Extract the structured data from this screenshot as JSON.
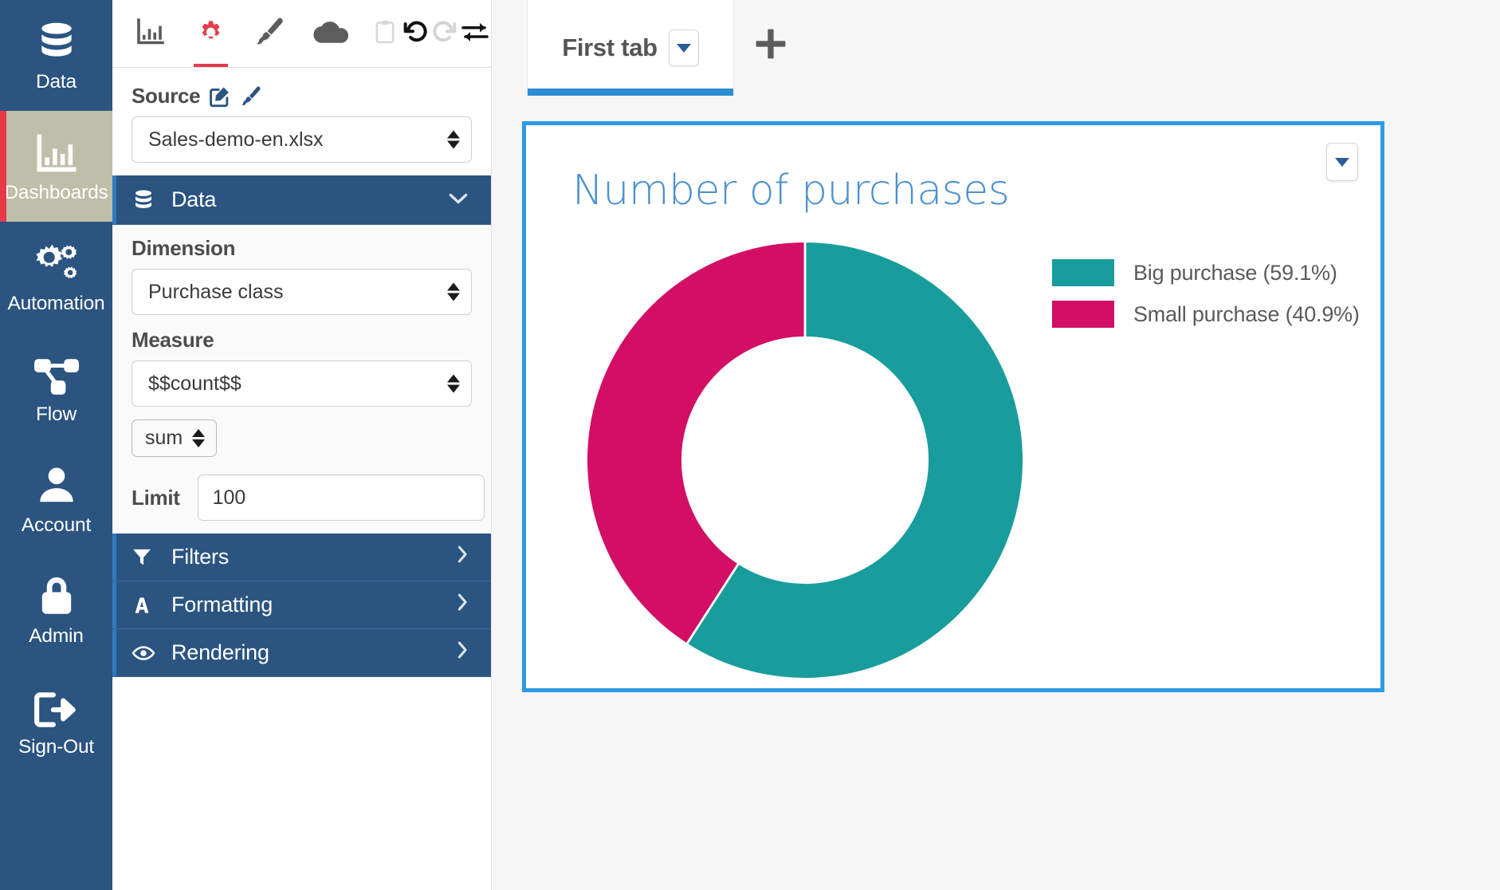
{
  "nav": {
    "items": [
      {
        "label": "Data",
        "icon": "database-icon",
        "active": false
      },
      {
        "label": "Dashboards",
        "icon": "bar-chart-icon",
        "active": true
      },
      {
        "label": "Automation",
        "icon": "gears-icon",
        "active": false
      },
      {
        "label": "Flow",
        "icon": "flow-nodes-icon",
        "active": false
      },
      {
        "label": "Account",
        "icon": "user-icon",
        "active": false
      },
      {
        "label": "Admin",
        "icon": "lock-icon",
        "active": false
      },
      {
        "label": "Sign-Out",
        "icon": "sign-out-icon",
        "active": false
      }
    ]
  },
  "toolstrip": {
    "tools": [
      {
        "name": "chart-icon",
        "state": "normal"
      },
      {
        "name": "gear-icon",
        "state": "active"
      },
      {
        "name": "paintbrush-icon",
        "state": "normal"
      },
      {
        "name": "cloud-icon",
        "state": "normal"
      },
      {
        "name": "clipboard-icon",
        "state": "disabled"
      },
      {
        "name": "undo-icon",
        "state": "enabled"
      },
      {
        "name": "redo-icon",
        "state": "disabled"
      },
      {
        "name": "swap-icon",
        "state": "enabled"
      }
    ]
  },
  "source": {
    "label": "Source",
    "edit_icon": "edit-square-icon",
    "brush_icon": "paintbrush-icon",
    "value": "Sales-demo-en.xlsx"
  },
  "data_section": {
    "header": "Data",
    "header_icon": "database-icon",
    "chevron": "chevron-down-icon",
    "dimension_label": "Dimension",
    "dimension_value": "Purchase class",
    "measure_label": "Measure",
    "measure_value": "$$count$$",
    "aggregation_value": "sum",
    "limit_label": "Limit",
    "limit_value": "100"
  },
  "accordions": [
    {
      "label": "Filters",
      "icon": "funnel-icon",
      "arrow": "chevron-right-icon"
    },
    {
      "label": "Formatting",
      "icon": "letter-a-icon",
      "arrow": "chevron-right-icon"
    },
    {
      "label": "Rendering",
      "icon": "eye-icon",
      "arrow": "chevron-right-icon"
    }
  ],
  "tabbar": {
    "tabs": [
      {
        "label": "First tab",
        "active": true,
        "caret": "chevron-down-icon"
      }
    ],
    "add_tab_label": "+"
  },
  "widget": {
    "menu_icon": "chevron-down-icon"
  },
  "colors": {
    "nav_bg": "#2B5480",
    "nav_active_bg": "#BFBEA8",
    "nav_active_marker": "#E8394B",
    "accent_red": "#E8394B",
    "tab_underline": "#2E8ED4",
    "widget_border": "#2E9AE4",
    "title_blue": "#4A91D0",
    "series_teal": "#199D9C",
    "series_pink": "#D20F64"
  },
  "chart_data": {
    "type": "pie",
    "variant": "donut",
    "title": "Number of purchases",
    "xlabel": "",
    "ylabel": "",
    "legend_position": "right",
    "start_angle_deg": 0,
    "direction": "clockwise",
    "inner_radius_ratio": 0.56,
    "categories": [
      "Big purchase",
      "Small purchase"
    ],
    "values": [
      59.1,
      40.9
    ],
    "colors": [
      "#199D9C",
      "#D20F64"
    ],
    "legend": [
      {
        "label": "Big purchase (59.1%)",
        "value": 59.1,
        "color": "#199D9C"
      },
      {
        "label": "Small purchase (40.9%)",
        "value": 40.9,
        "color": "#D20F64"
      }
    ],
    "units": "percent"
  }
}
